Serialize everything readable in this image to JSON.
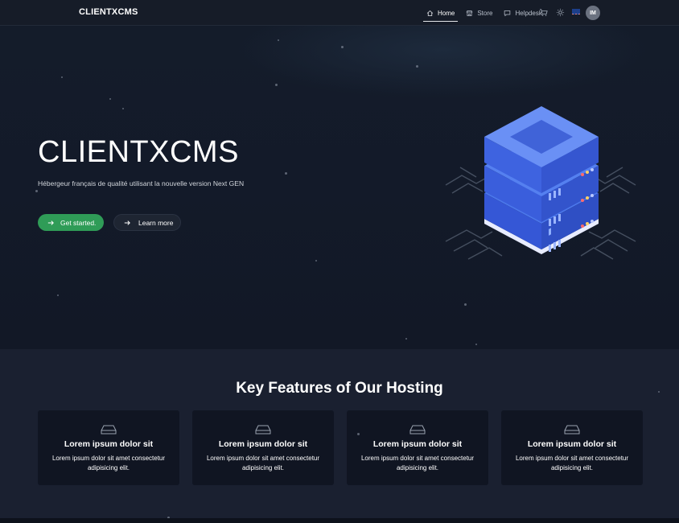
{
  "nav": {
    "brand": "CLIENTXCMS",
    "links": [
      {
        "label": "Home",
        "icon": "home-icon",
        "active": true
      },
      {
        "label": "Store",
        "icon": "store-icon",
        "active": false
      },
      {
        "label": "Helpdesk",
        "icon": "chat-icon",
        "active": false
      }
    ],
    "cart_icon": "cart-icon",
    "theme_icon": "sun-icon",
    "language_flag": "uk-flag-icon",
    "avatar_initials": "IM"
  },
  "hero": {
    "title": "CLIENTXCMS",
    "subtitle": "Hébergeur français de qualité utilisant la nouvelle version Next GEN",
    "primary_button": "Get started.",
    "secondary_button": "Learn more",
    "illustration": "server-rack-illustration"
  },
  "features": {
    "title": "Key Features of Our Hosting",
    "cards": [
      {
        "icon": "hard-drive-icon",
        "title": "Lorem ipsum dolor sit",
        "text": "Lorem ipsum dolor sit amet consectetur adipisicing elit."
      },
      {
        "icon": "hard-drive-icon",
        "title": "Lorem ipsum dolor sit",
        "text": "Lorem ipsum dolor sit amet consectetur adipisicing elit."
      },
      {
        "icon": "hard-drive-icon",
        "title": "Lorem ipsum dolor sit",
        "text": "Lorem ipsum dolor sit amet consectetur adipisicing elit."
      },
      {
        "icon": "hard-drive-icon",
        "title": "Lorem ipsum dolor sit",
        "text": "Lorem ipsum dolor sit amet consectetur adipisicing elit."
      }
    ]
  },
  "colors": {
    "accent_green": "#2f9c57",
    "server_blue": "#3b63e0",
    "background": "#131a29",
    "card_bg": "#101522"
  }
}
